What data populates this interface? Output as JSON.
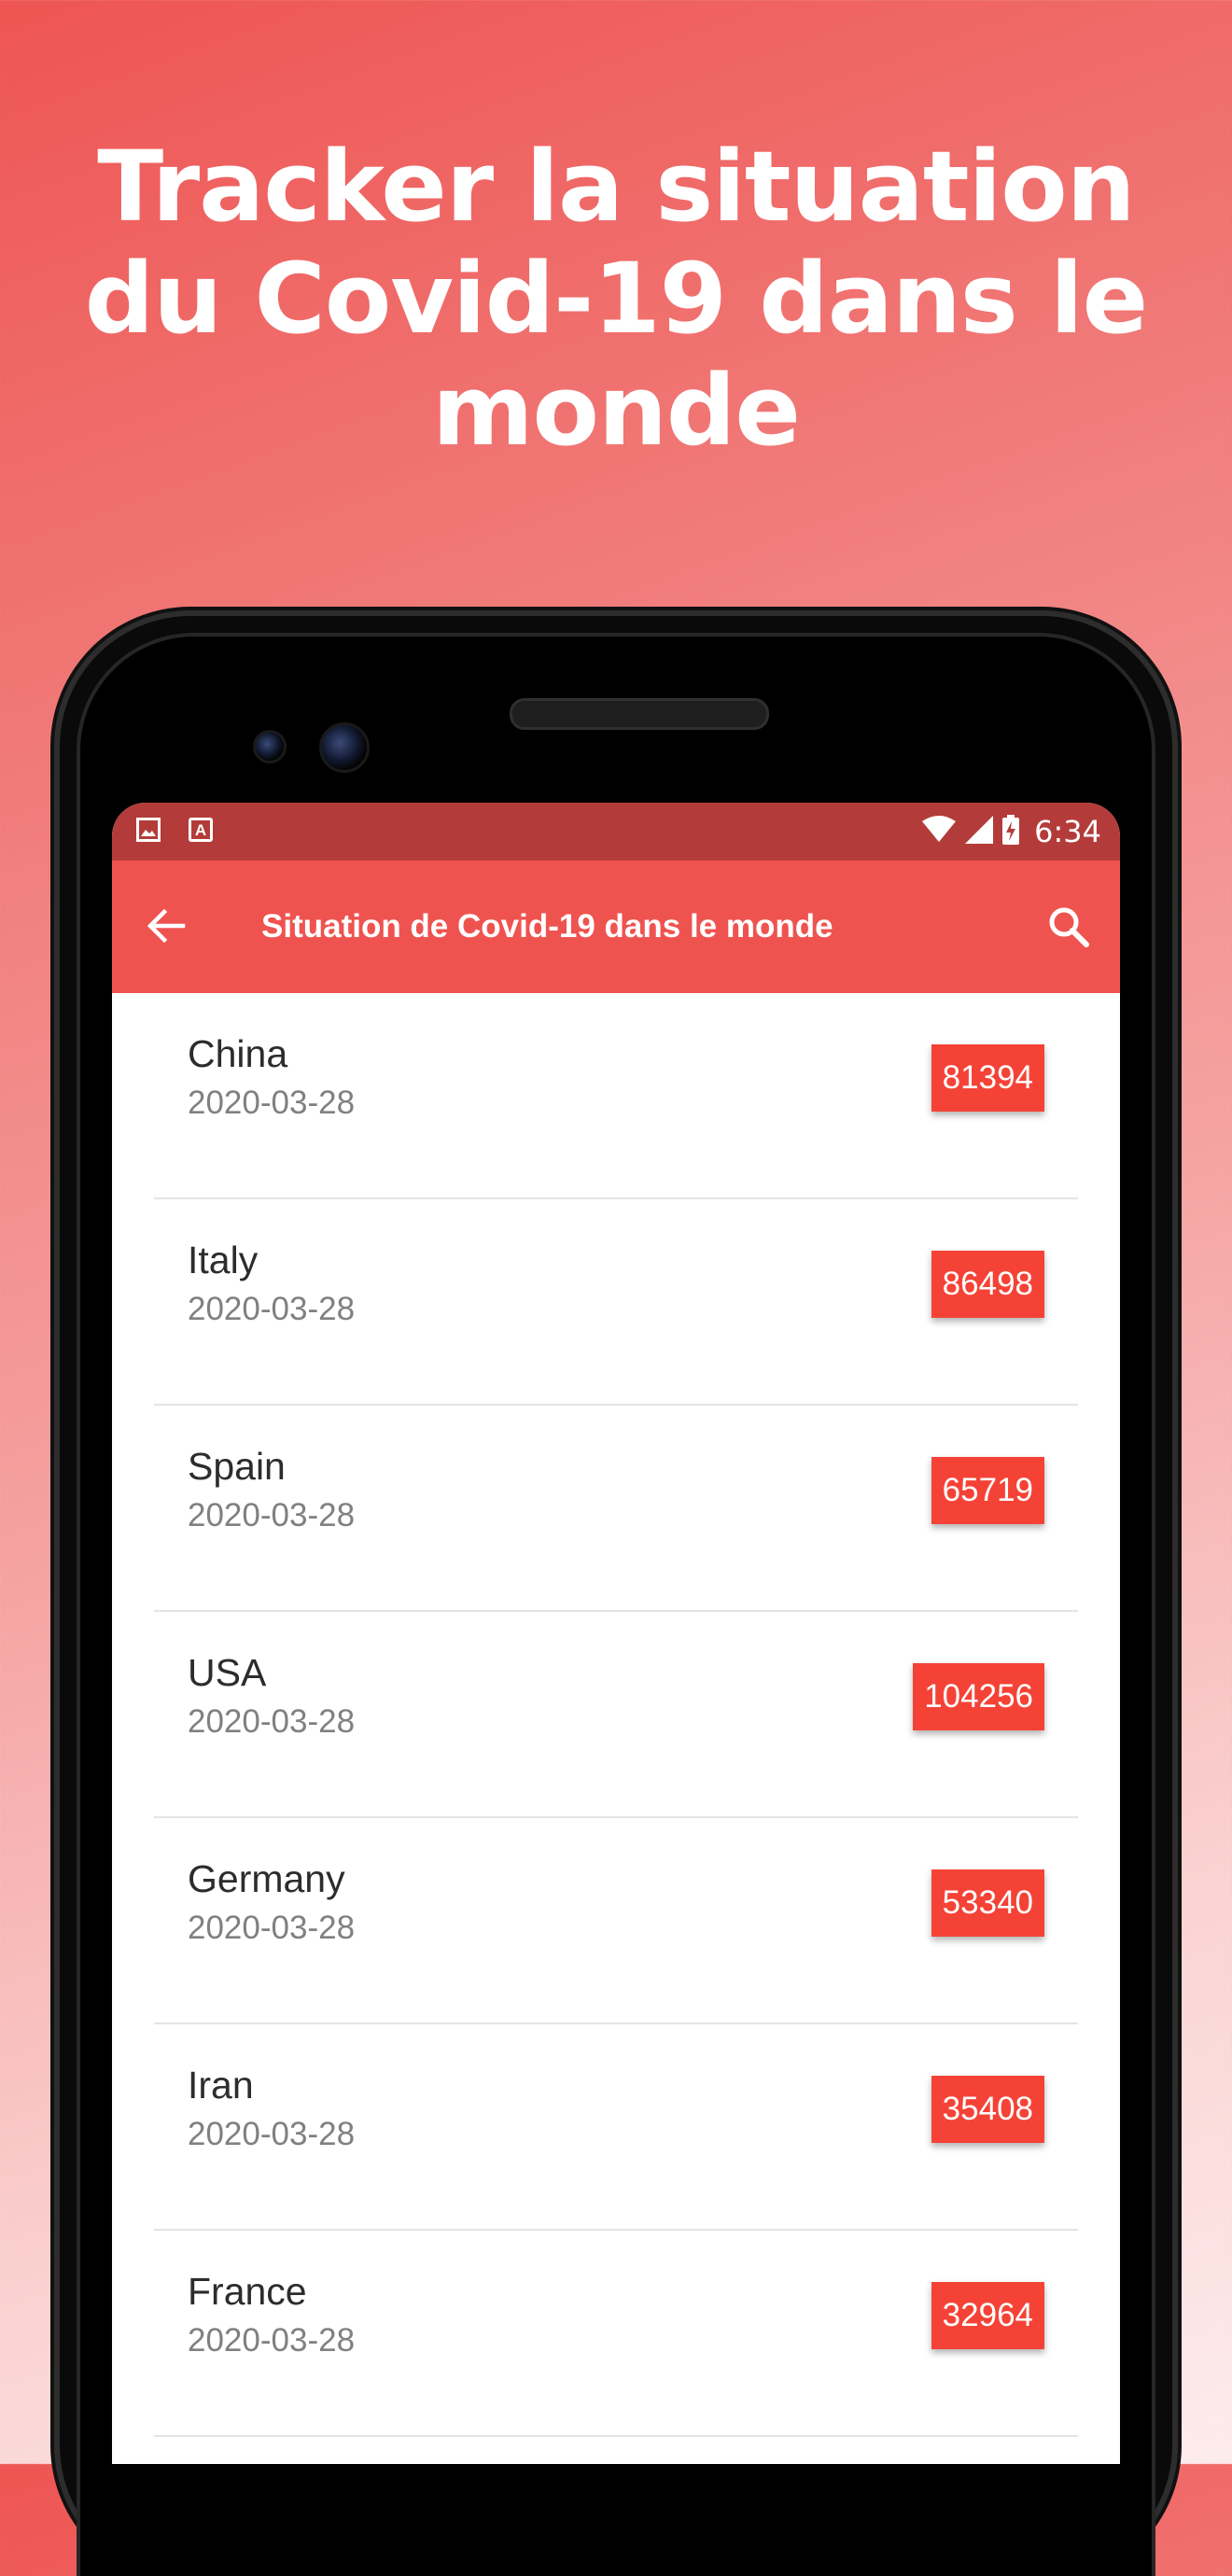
{
  "headline": {
    "lines": [
      "Tracker la situation",
      "du Covid-19 dans le",
      "monde"
    ]
  },
  "status_bar": {
    "time": "6:34",
    "left_icons": [
      "image-icon",
      "a-letter-icon"
    ],
    "right_icons": [
      "wifi-icon",
      "signal-icon",
      "battery-charging-icon"
    ]
  },
  "toolbar": {
    "title": "Situation de Covid-19 dans le monde",
    "back_icon": "arrow-back-icon",
    "search_icon": "search-icon"
  },
  "countries": [
    {
      "name": "China",
      "date": "2020-03-28",
      "cases": "81394"
    },
    {
      "name": "Italy",
      "date": "2020-03-28",
      "cases": "86498"
    },
    {
      "name": "Spain",
      "date": "2020-03-28",
      "cases": "65719"
    },
    {
      "name": "USA",
      "date": "2020-03-28",
      "cases": "104256"
    },
    {
      "name": "Germany",
      "date": "2020-03-28",
      "cases": "53340"
    },
    {
      "name": "Iran",
      "date": "2020-03-28",
      "cases": "35408"
    },
    {
      "name": "France",
      "date": "2020-03-28",
      "cases": "32964"
    }
  ],
  "colors": {
    "status_bar": "#b33c3a",
    "toolbar": "#ef5350",
    "badge": "#f44336",
    "background_top": "#ee5553",
    "background_bottom": "#fdecec"
  }
}
